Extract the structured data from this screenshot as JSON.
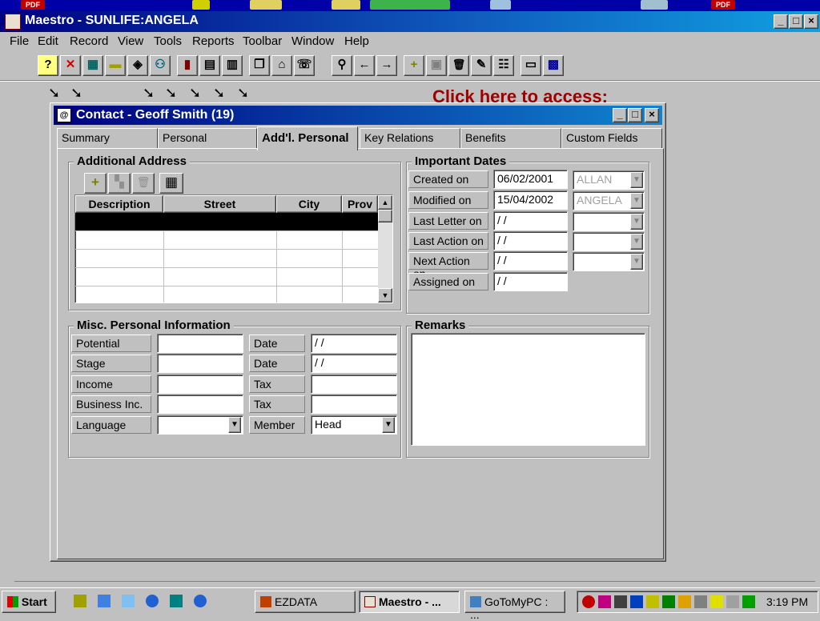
{
  "main_window": {
    "title": "Maestro - SUNLIFE:ANGELA",
    "controls": [
      "_",
      "□",
      "×"
    ]
  },
  "desktop": {
    "icon_labels": [
      "PDF",
      "PDF"
    ]
  },
  "menu": [
    "File",
    "Edit",
    "Record",
    "View",
    "Tools",
    "Reports",
    "Toolbar",
    "Window",
    "Help"
  ],
  "toolbar": {
    "buttons": [
      {
        "name": "help-icon",
        "glyph": "?"
      },
      {
        "name": "close-x-icon",
        "glyph": "✕"
      },
      {
        "name": "calculator-icon",
        "glyph": "▦"
      },
      {
        "name": "minus-icon",
        "glyph": "▬"
      },
      {
        "name": "card-icon",
        "glyph": "◈"
      },
      {
        "name": "people-icon",
        "glyph": "⚇"
      },
      {
        "name": "book-icon",
        "glyph": "▮"
      },
      {
        "name": "ledger-icon",
        "glyph": "▤"
      },
      {
        "name": "form-icon",
        "glyph": "▥"
      },
      {
        "name": "copy-icon",
        "glyph": "❐"
      },
      {
        "name": "house-icon",
        "glyph": "⌂"
      },
      {
        "name": "phone-icon",
        "glyph": "☏"
      },
      {
        "name": "binoculars-icon",
        "glyph": "⚲"
      },
      {
        "name": "arrow-left-icon",
        "glyph": "←"
      },
      {
        "name": "arrow-right-icon",
        "glyph": "→"
      },
      {
        "name": "add-icon",
        "glyph": "+"
      },
      {
        "name": "save-icon",
        "glyph": "▣"
      },
      {
        "name": "trash-icon",
        "glyph": "🗑"
      },
      {
        "name": "edit-icon",
        "glyph": "✎"
      },
      {
        "name": "list-icon",
        "glyph": "☷"
      },
      {
        "name": "note-icon",
        "glyph": "▭"
      },
      {
        "name": "grid-icon",
        "glyph": "▩"
      }
    ]
  },
  "background_hint": {
    "link_text": "Click here to access:"
  },
  "contact_window": {
    "title": "Contact - Geoff Smith (19)",
    "controls": [
      "_",
      "□",
      "×"
    ],
    "tabs": [
      {
        "label": "Summary",
        "active": false
      },
      {
        "label": "Personal",
        "active": false
      },
      {
        "label": "Add'l. Personal",
        "active": true
      },
      {
        "label": "Key Relations",
        "active": false
      },
      {
        "label": "Benefits",
        "active": false
      },
      {
        "label": "Custom Fields",
        "active": false
      }
    ],
    "additional_address": {
      "title": "Additional Address",
      "buttons": [
        {
          "name": "add-address-button",
          "glyph": "+"
        },
        {
          "name": "edit-address-button",
          "glyph": "▚"
        },
        {
          "name": "delete-address-button",
          "glyph": "🗑"
        },
        {
          "name": "grid-view-button",
          "glyph": "▦"
        }
      ],
      "columns": [
        "Description",
        "Street",
        "City",
        "Prov"
      ]
    },
    "important_dates": {
      "title": "Important Dates",
      "rows": [
        {
          "label": "Created on",
          "value": "06/02/2001",
          "user": "ALLAN"
        },
        {
          "label": "Modified on",
          "value": "15/04/2002",
          "user": "ANGELA"
        },
        {
          "label": "Last Letter on",
          "value": " / /",
          "user": ""
        },
        {
          "label": "Last Action on",
          "value": " / /",
          "user": ""
        },
        {
          "label": "Next Action on",
          "value": " / /",
          "user": ""
        },
        {
          "label": "Assigned on",
          "value": " / /"
        }
      ]
    },
    "misc_info": {
      "title": "Misc. Personal Information",
      "rows": [
        {
          "label": "Potential",
          "value": "",
          "label2": "Date",
          "value2": " / /"
        },
        {
          "label": "Stage",
          "value": "",
          "label2": "Date",
          "value2": " / /"
        },
        {
          "label": "Income",
          "value": "",
          "label2": "Tax",
          "value2": ""
        },
        {
          "label": "Business Inc.",
          "value": "",
          "label2": "Tax",
          "value2": ""
        },
        {
          "label": "Language",
          "value": "",
          "label2": "Member",
          "value2": "Head"
        }
      ]
    },
    "remarks": {
      "title": "Remarks",
      "value": ""
    }
  },
  "taskbar": {
    "start_label": "Start",
    "tasks": [
      "EZDATA",
      "Maestro - ...",
      "GoToMyPC : ..."
    ],
    "clock": "3:19 PM"
  },
  "colors": {
    "title_active": "#000080",
    "title_gradient_end": "#1084d0",
    "link_red": "#a00000",
    "window_face": "#c0c0c0",
    "selected_row": "#000000"
  }
}
